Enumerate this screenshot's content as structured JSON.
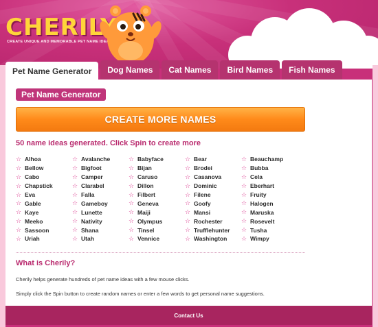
{
  "brand": {
    "logo": "CHERILY",
    "tagline": "CREATE UNIQUE AND MEMORABLE PET NAME IDEAS"
  },
  "tabs": [
    {
      "label": "Pet Name Generator",
      "active": true
    },
    {
      "label": "Dog Names"
    },
    {
      "label": "Cat Names"
    },
    {
      "label": "Bird Names"
    },
    {
      "label": "Fish Names"
    }
  ],
  "section_title": "Pet Name Generator",
  "spin_button": "CREATE MORE NAMES",
  "status": "50 name ideas generated. Click Spin to create more",
  "names": [
    "Alhoa",
    "Bellow",
    "Cabo",
    "Chapstick",
    "Eva",
    "Gable",
    "Kaye",
    "Meeko",
    "Sassoon",
    "Uriah",
    "Avalanche",
    "Bigfoot",
    "Camper",
    "Clarabel",
    "Falla",
    "Gameboy",
    "Lunette",
    "Nativity",
    "Shana",
    "Utah",
    "Babyface",
    "Bijan",
    "Caruso",
    "Dillon",
    "Filbert",
    "Geneva",
    "Maiji",
    "Olympus",
    "Tinsel",
    "Vennice",
    "Bear",
    "Brodei",
    "Casanova",
    "Dominic",
    "Filene",
    "Goofy",
    "Mansi",
    "Rochester",
    "Trufflehunter",
    "Washington",
    "Beauchamp",
    "Bubba",
    "Cela",
    "Eberhart",
    "Fruity",
    "Halogen",
    "Maruska",
    "Rosevelt",
    "Tusha",
    "Wimpy"
  ],
  "about": {
    "title": "What is Cherily?",
    "p1": "Cherily helps generate hundreds of pet name ideas with a few mouse clicks.",
    "p2": "Simply click the Spin button to create random names or enter a few words to get personal name suggestions."
  },
  "footer": "Contact Us",
  "colors": {
    "brand_pink": "#c8307a",
    "accent_orange": "#ff8a1a",
    "logo_yellow": "#ffd43a"
  }
}
